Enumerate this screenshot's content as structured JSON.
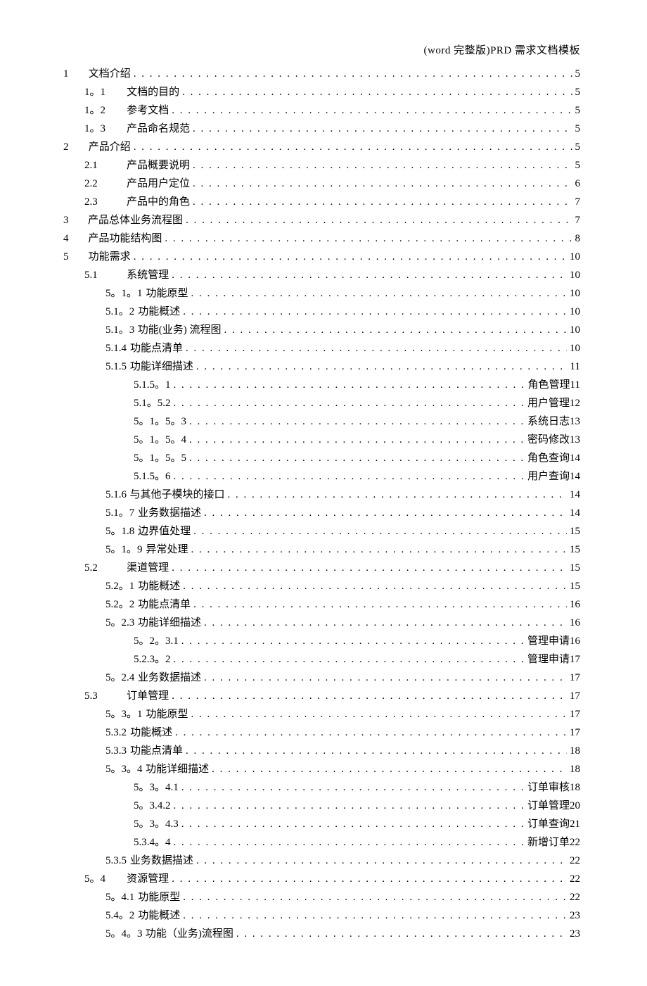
{
  "header": "(word 完整版)PRD 需求文档模板",
  "toc": [
    {
      "level": 1,
      "num": "1",
      "title": "文档介绍",
      "suffix": "",
      "page": "5"
    },
    {
      "level": 2,
      "num": "1。1",
      "title": "文档的目的",
      "suffix": "",
      "page": "5"
    },
    {
      "level": 2,
      "num": "1。2",
      "title": "参考文档",
      "suffix": "",
      "page": "5"
    },
    {
      "level": 2,
      "num": "1。3",
      "title": "产品命名规范",
      "suffix": "",
      "page": "5"
    },
    {
      "level": 1,
      "num": "2",
      "title": "产品介绍",
      "suffix": "",
      "page": "5"
    },
    {
      "level": 2,
      "num": "2.1",
      "title": "产品概要说明",
      "suffix": "",
      "page": "5"
    },
    {
      "level": 2,
      "num": "2.2",
      "title": "产品用户定位",
      "suffix": "",
      "page": "6"
    },
    {
      "level": 2,
      "num": "2.3",
      "title": "产品中的角色",
      "suffix": "",
      "page": "7"
    },
    {
      "level": 1,
      "num": "3",
      "title": "产品总体业务流程图",
      "suffix": "",
      "page": "7"
    },
    {
      "level": 1,
      "num": "4",
      "title": "产品功能结构图",
      "suffix": "",
      "page": "8"
    },
    {
      "level": 1,
      "num": "5",
      "title": "功能需求",
      "suffix": "",
      "page": "10"
    },
    {
      "level": 2,
      "num": "5.1",
      "title": "系统管理",
      "suffix": "",
      "page": "10"
    },
    {
      "level": 3,
      "num": "5。1。1",
      "title": "功能原型",
      "suffix": "",
      "page": "10"
    },
    {
      "level": 3,
      "num": "5.1。2",
      "title": "功能概述",
      "suffix": "",
      "page": "10"
    },
    {
      "level": 3,
      "num": "5.1。3",
      "title": "功能(业务) 流程图",
      "suffix": "",
      "page": "10"
    },
    {
      "level": 3,
      "num": "5.1.4",
      "title": "功能点清单",
      "suffix": "",
      "page": "10"
    },
    {
      "level": 3,
      "num": "5.1.5",
      "title": "功能详细描述",
      "suffix": "",
      "page": "11"
    },
    {
      "level": 4,
      "num": "5.1.5。1",
      "title": "",
      "suffix": "角色管理",
      "page": "11"
    },
    {
      "level": 4,
      "num": "5.1。5.2",
      "title": "",
      "suffix": "用户管理",
      "page": "12"
    },
    {
      "level": 4,
      "num": "5。1。5。3",
      "title": "",
      "suffix": "系统日志",
      "page": "13"
    },
    {
      "level": 4,
      "num": "5。1。5。4",
      "title": "",
      "suffix": "密码修改",
      "page": "13"
    },
    {
      "level": 4,
      "num": "5。1。5。5",
      "title": "",
      "suffix": "角色查询",
      "page": "14"
    },
    {
      "level": 4,
      "num": "5.1.5。6",
      "title": "",
      "suffix": "用户查询",
      "page": "14"
    },
    {
      "level": 3,
      "num": "5.1.6",
      "title": "与其他子模块的接口",
      "suffix": "",
      "page": "14"
    },
    {
      "level": 3,
      "num": "5.1。7",
      "title": "业务数据描述",
      "suffix": "",
      "page": "14"
    },
    {
      "level": 3,
      "num": "5。1.8",
      "title": "边界值处理",
      "suffix": "",
      "page": "15"
    },
    {
      "level": 3,
      "num": "5。1。9",
      "title": "异常处理",
      "suffix": "",
      "page": "15"
    },
    {
      "level": 2,
      "num": "5.2",
      "title": "渠道管理",
      "suffix": "",
      "page": "15"
    },
    {
      "level": 3,
      "num": "5.2。1",
      "title": "功能概述",
      "suffix": "",
      "page": "15"
    },
    {
      "level": 3,
      "num": "5.2。2",
      "title": "功能点清单",
      "suffix": "",
      "page": "16"
    },
    {
      "level": 3,
      "num": "5。2.3",
      "title": "功能详细描述",
      "suffix": "",
      "page": "16"
    },
    {
      "level": 4,
      "num": "5。2。3.1",
      "title": "",
      "suffix": "管理申请",
      "page": "16"
    },
    {
      "level": 4,
      "num": "5.2.3。2",
      "title": "",
      "suffix": "管理申请",
      "page": "17"
    },
    {
      "level": 3,
      "num": "5。2.4",
      "title": "业务数据描述",
      "suffix": "",
      "page": "17"
    },
    {
      "level": 2,
      "num": "5.3",
      "title": "订单管理",
      "suffix": "",
      "page": "17"
    },
    {
      "level": 3,
      "num": "5。3。1",
      "title": "功能原型",
      "suffix": "",
      "page": "17"
    },
    {
      "level": 3,
      "num": "5.3.2",
      "title": "功能概述",
      "suffix": "",
      "page": "17"
    },
    {
      "level": 3,
      "num": "5.3.3",
      "title": "功能点清单",
      "suffix": "",
      "page": "18"
    },
    {
      "level": 3,
      "num": "5。3。4",
      "title": "功能详细描述",
      "suffix": "",
      "page": "18"
    },
    {
      "level": 4,
      "num": "5。3。4.1",
      "title": "",
      "suffix": "订单审核",
      "page": "18"
    },
    {
      "level": 4,
      "num": "5。3.4.2",
      "title": "",
      "suffix": "订单管理",
      "page": "20"
    },
    {
      "level": 4,
      "num": "5。3。4.3",
      "title": "",
      "suffix": "订单查询",
      "page": "21"
    },
    {
      "level": 4,
      "num": "5.3.4。4",
      "title": "",
      "suffix": "新增订单",
      "page": "22"
    },
    {
      "level": 3,
      "num": "5.3.5",
      "title": "业务数据描述",
      "suffix": "",
      "page": "22"
    },
    {
      "level": 2,
      "num": "5。4",
      "title": "资源管理",
      "suffix": "",
      "page": "22"
    },
    {
      "level": 3,
      "num": "5。4.1",
      "title": "功能原型",
      "suffix": "",
      "page": "22"
    },
    {
      "level": 3,
      "num": "5.4。2",
      "title": "功能概述",
      "suffix": "",
      "page": "23"
    },
    {
      "level": 3,
      "num": "5。4。3",
      "title": "功能（业务)流程图",
      "suffix": "",
      "page": "23"
    }
  ]
}
